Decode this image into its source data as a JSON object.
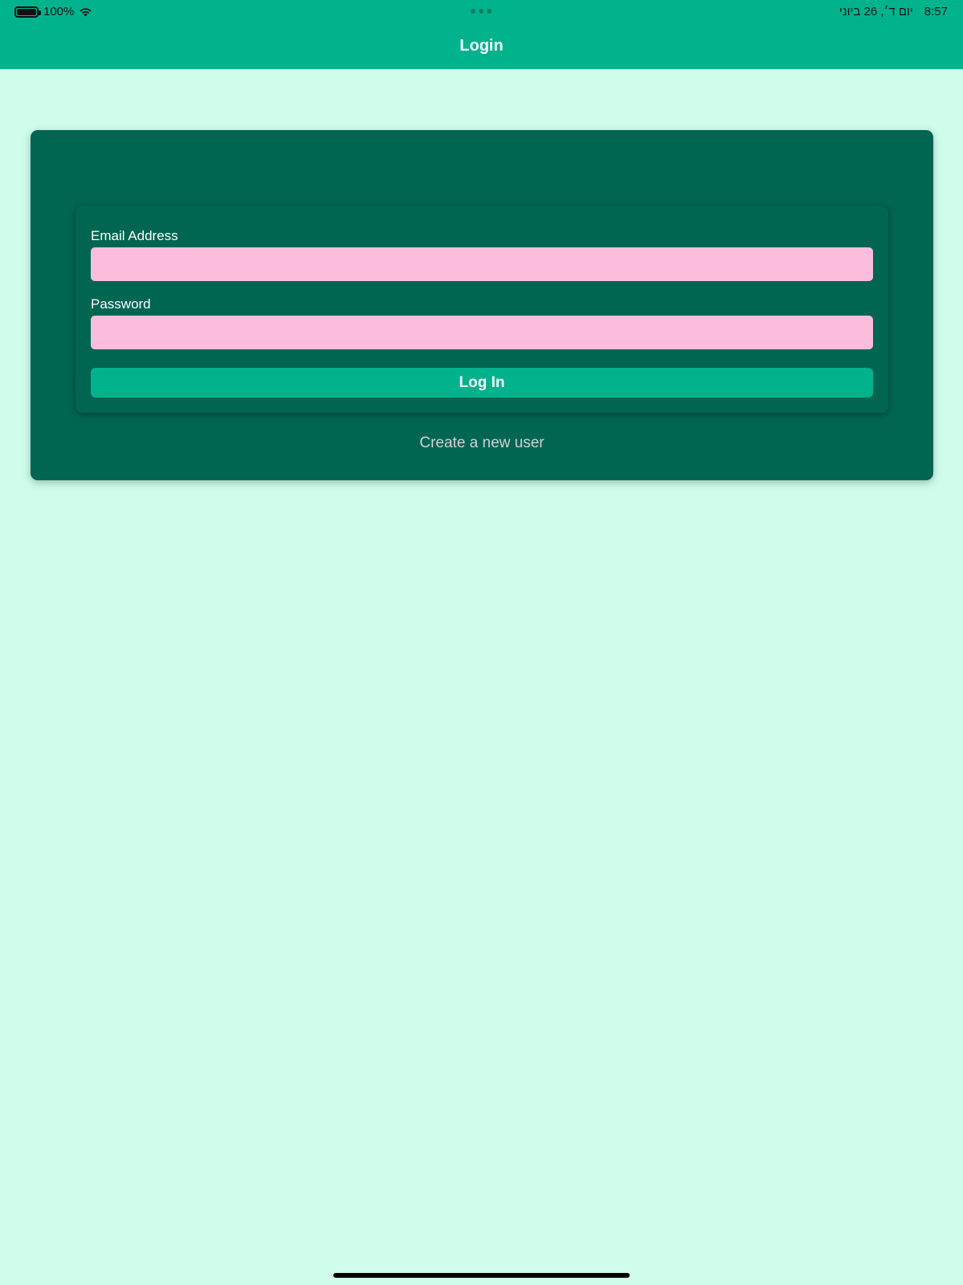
{
  "status_bar": {
    "battery_text": "100%",
    "battery_level": 1.0,
    "date": "יום ד׳, 26 ביוני",
    "time": "8:57",
    "icons": [
      "battery-icon",
      "wifi-icon"
    ]
  },
  "nav": {
    "title": "Login"
  },
  "form": {
    "email_label": "Email Address",
    "email_value": "",
    "password_label": "Password",
    "password_value": "",
    "login_button_label": "Log In"
  },
  "links": {
    "create_user": "Create a new user"
  },
  "colors": {
    "header": "#00b38d",
    "background": "#cffceb",
    "card": "#006651",
    "input": "#fbbddb",
    "button": "#00b38d"
  }
}
